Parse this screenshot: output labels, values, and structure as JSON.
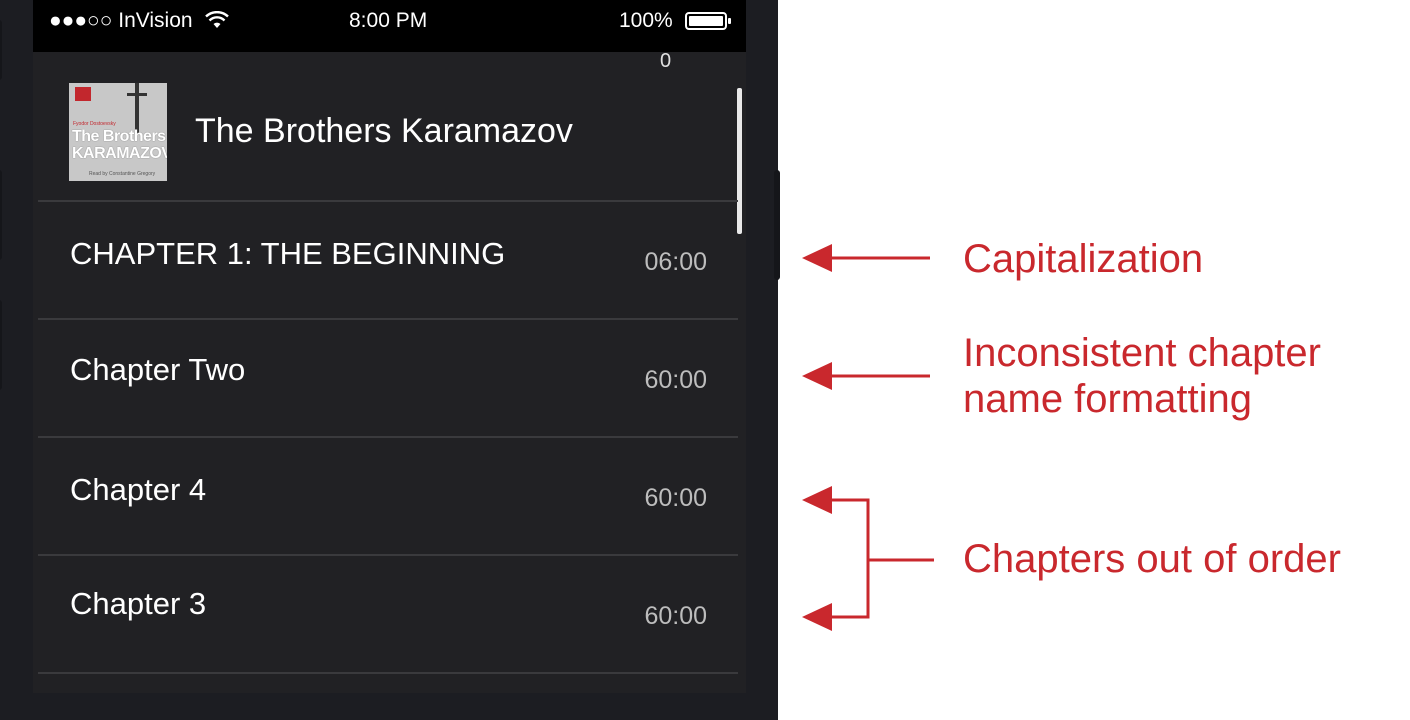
{
  "status_bar": {
    "carrier": "●●●○○ InVision",
    "time": "8:00 PM",
    "battery": "100%"
  },
  "scroll_counter": "0",
  "book": {
    "title": "The Brothers Karamazov",
    "cover": {
      "author": "Fyodor Dostoevsky",
      "title_line1": "The Brothers",
      "title_line2": "KARAMAZOV",
      "reader": "Read by Constantine Gregory"
    }
  },
  "chapters": [
    {
      "name": "CHAPTER 1: THE BEGINNING",
      "duration": "06:00"
    },
    {
      "name": "Chapter Two",
      "duration": "60:00"
    },
    {
      "name": "Chapter 4",
      "duration": "60:00"
    },
    {
      "name": "Chapter 3",
      "duration": "60:00"
    }
  ],
  "annotations": {
    "capitalization": "Capitalization",
    "inconsistent_line1": "Inconsistent chapter",
    "inconsistent_line2": "name formatting",
    "out_of_order": "Chapters out of order"
  },
  "colors": {
    "annotation": "#c9282d",
    "screen_bg": "#212124",
    "phone_frame": "#1c1d22"
  },
  "icons": [
    "signal-dots-icon",
    "wifi-icon",
    "battery-icon",
    "arrow-left-icon",
    "bracket-arrow-icon"
  ]
}
